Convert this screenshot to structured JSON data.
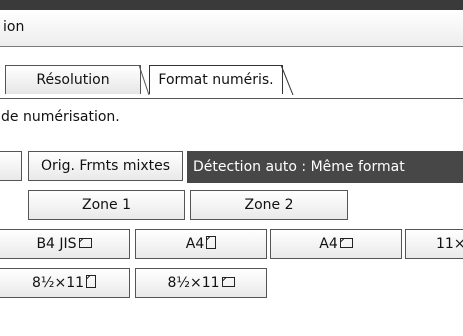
{
  "title": "ion",
  "tabs": [
    {
      "label": "Résolution"
    },
    {
      "label": "Format numéris."
    }
  ],
  "instruction": "de numérisation.",
  "mixed_sizes_button": "Orig. Frmts mixtes",
  "status_text": "Détection auto : Même format",
  "zones": [
    "Zone 1",
    "Zone 2"
  ],
  "sizes_row1": [
    {
      "label": "B4 JIS",
      "icon": "landscape-paper-icon"
    },
    {
      "label": "A4",
      "icon": "portrait-paper-icon"
    },
    {
      "label": "A4",
      "icon": "landscape-paper-icon"
    },
    {
      "label": "11×"
    }
  ],
  "sizes_row2": [
    {
      "label": "8½×11",
      "icon": "portrait-paper-icon"
    },
    {
      "label": "8½×11",
      "icon": "landscape-paper-icon"
    }
  ]
}
